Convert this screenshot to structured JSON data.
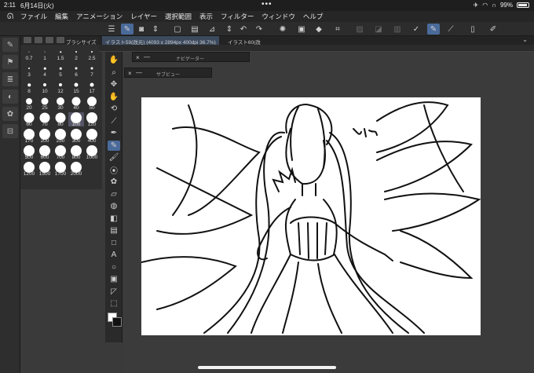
{
  "status_bar": {
    "time": "2:11",
    "date": "6月14日(火)",
    "battery": "99%"
  },
  "menu": {
    "logo": "ᘏ",
    "items": [
      "ファイル",
      "編集",
      "アニメーション",
      "レイヤー",
      "選択範囲",
      "表示",
      "フィルター",
      "ウィンドウ",
      "ヘルプ"
    ]
  },
  "toolbar": {
    "icons": [
      "menu-icon",
      "brush-icon",
      "eraser-icon",
      "stepper-icon",
      "new-file-icon",
      "open-icon",
      "save-icon",
      "upload-icon",
      "stepper-icon",
      "undo-icon",
      "redo-icon",
      "spinner-icon",
      "fill-icon",
      "paint-icon",
      "transform-icon",
      "hatch-icon",
      "clear-icon",
      "gradient-icon",
      "select-icon",
      "ruler-icon",
      "pen-icon",
      "pencil-icon",
      "phone-icon",
      "edit-icon"
    ]
  },
  "brush_panel": {
    "title": "ブラシサイズ",
    "sizes": [
      {
        "label": "0.7",
        "d": 1
      },
      {
        "label": "1",
        "d": 1
      },
      {
        "label": "1.5",
        "d": 1.5
      },
      {
        "label": "2",
        "d": 2
      },
      {
        "label": "2.5",
        "d": 2
      },
      {
        "label": "3",
        "d": 2
      },
      {
        "label": "4",
        "d": 2.5
      },
      {
        "label": "5",
        "d": 2.5
      },
      {
        "label": "6",
        "d": 3
      },
      {
        "label": "7",
        "d": 3
      },
      {
        "label": "8",
        "d": 3.5
      },
      {
        "label": "10",
        "d": 4
      },
      {
        "label": "12",
        "d": 4
      },
      {
        "label": "15",
        "d": 5
      },
      {
        "label": "17",
        "d": 5
      },
      {
        "label": "20",
        "d": 8
      },
      {
        "label": "25",
        "d": 9
      },
      {
        "label": "30",
        "d": 10
      },
      {
        "label": "40",
        "d": 11
      },
      {
        "label": "50",
        "d": 12
      },
      {
        "label": "60",
        "d": 13
      },
      {
        "label": "70",
        "d": 13
      },
      {
        "label": "80",
        "d": 13
      },
      {
        "label": "100",
        "d": 14
      },
      {
        "label": "120",
        "d": 14
      },
      {
        "label": "170",
        "d": 14
      },
      {
        "label": "200",
        "d": 14
      },
      {
        "label": "250",
        "d": 14
      },
      {
        "label": "300",
        "d": 14
      },
      {
        "label": "400",
        "d": 14
      },
      {
        "label": "500",
        "d": 14
      },
      {
        "label": "600",
        "d": 14
      },
      {
        "label": "700",
        "d": 14
      },
      {
        "label": "800",
        "d": 14
      },
      {
        "label": "1000",
        "d": 14
      },
      {
        "label": "1200",
        "d": 14
      },
      {
        "label": "1500",
        "d": 14
      },
      {
        "label": "1700",
        "d": 14
      },
      {
        "label": "2000",
        "d": 14
      }
    ],
    "selected": "100"
  },
  "doc_tabs": [
    {
      "label": "イラスト59(改元) (4093 x 2894px 400dpi 36.7%)",
      "active": true
    },
    {
      "label": "イラスト60(改",
      "active": false
    }
  ],
  "panels": {
    "navigator": "ナビゲーター",
    "subview": "サブビュー"
  },
  "tools": [
    "hand-icon",
    "zoom-icon",
    "move-icon",
    "hand-icon",
    "rotate-icon",
    "eyedropper-icon",
    "pen-icon",
    "pencil-icon",
    "brush-icon",
    "airbrush-icon",
    "decoration-icon",
    "eraser-icon",
    "blend-icon",
    "fill-icon",
    "gradient-icon",
    "figure-icon",
    "text-icon",
    "balloon-icon",
    "frame-icon",
    "ruler-icon",
    "select-icon"
  ],
  "colors": {
    "accent": "#4a6a9a",
    "canvas": "#ffffff",
    "main_color": "#ffffff",
    "sub_color": "#111111"
  }
}
